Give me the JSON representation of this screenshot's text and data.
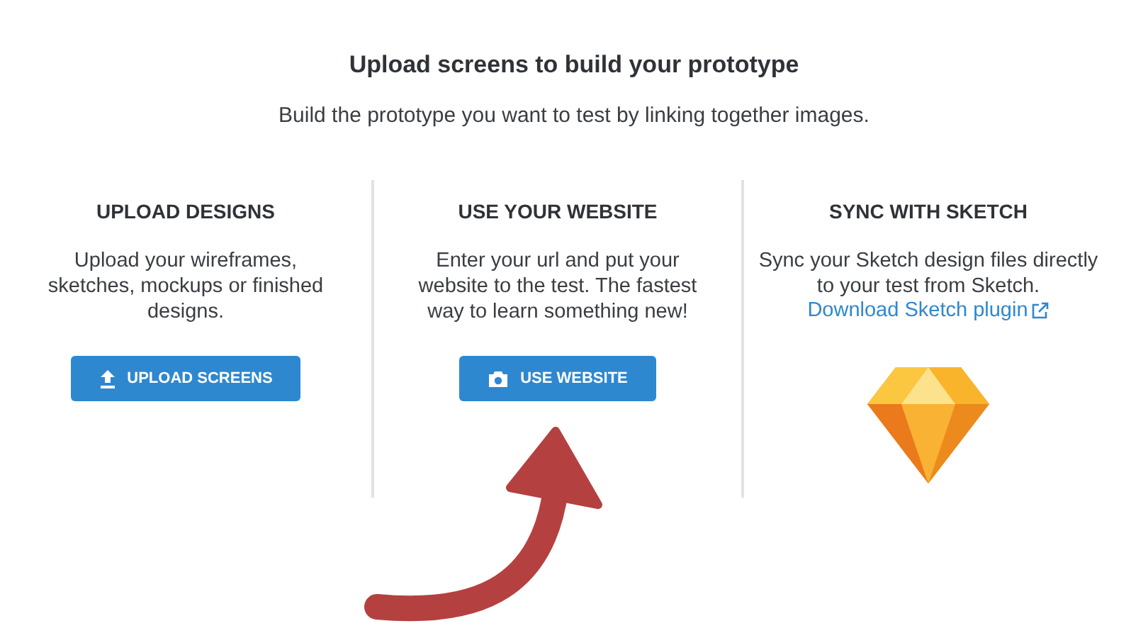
{
  "header": {
    "title": "Upload screens to build your prototype",
    "subtitle": "Build the prototype you want to test by linking together images."
  },
  "options": [
    {
      "kind": "button",
      "heading": "UPLOAD DESIGNS",
      "description": "Upload your wireframes, sketches, mockups or finished designs.",
      "button": {
        "label": "UPLOAD SCREENS"
      }
    },
    {
      "kind": "button",
      "heading": "USE YOUR WEBSITE",
      "description": "Enter your url and put your website to the test. The fastest way to learn something new!",
      "button": {
        "label": "USE WEBSITE"
      }
    },
    {
      "kind": "plugin",
      "heading": "SYNC WITH SKETCH",
      "description": "Sync your Sketch design files directly to your test from Sketch.",
      "link": "Download Sketch plugin"
    }
  ]
}
